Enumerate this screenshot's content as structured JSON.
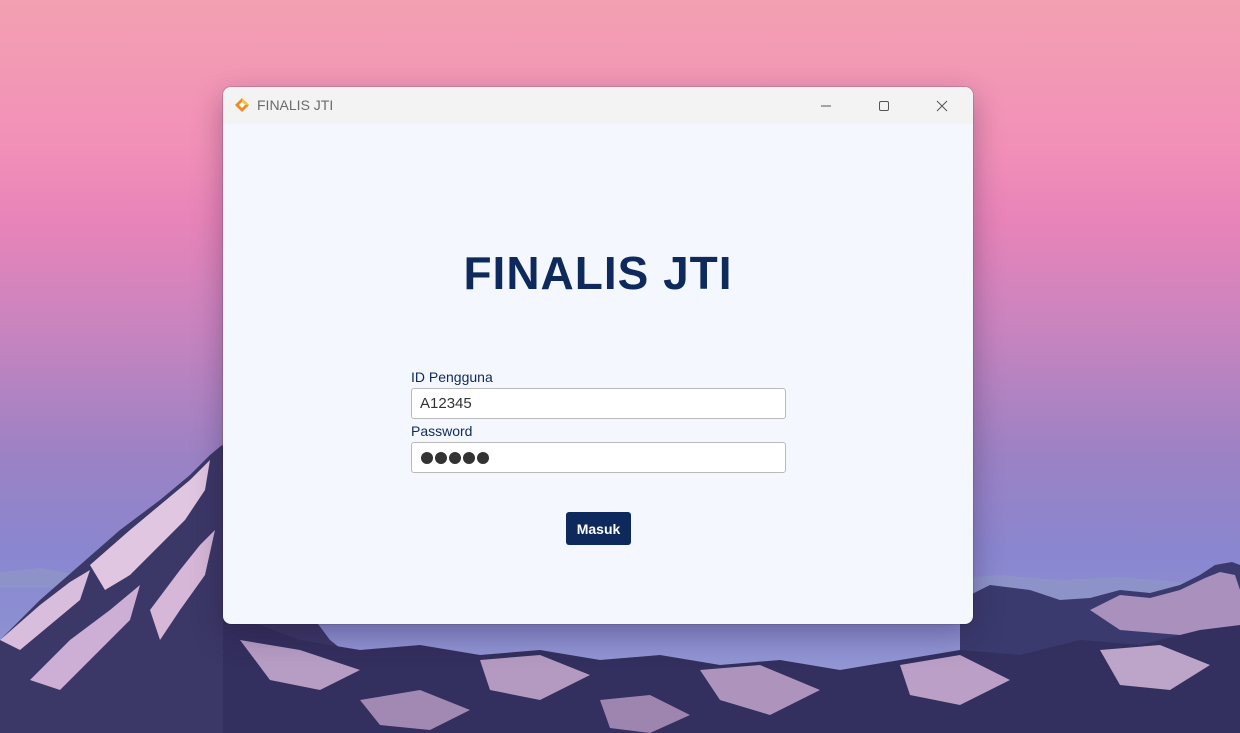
{
  "window": {
    "title": "FINALIS JTI",
    "icon": "app-diamond-icon",
    "controls": [
      "minimize-icon",
      "maximize-icon",
      "close-icon"
    ]
  },
  "login": {
    "heading": "FINALIS JTI",
    "user_label": "ID Pengguna",
    "user_value": "A12345",
    "password_label": "Password",
    "password_masked_length": 5,
    "submit_label": "Masuk"
  },
  "colors": {
    "brand_navy": "#0e2a5c",
    "window_bg": "#f4f7fd",
    "titlebar_bg": "#f3f3f3",
    "icon_orange": "#f08a24",
    "icon_yellow": "#f5c242"
  }
}
